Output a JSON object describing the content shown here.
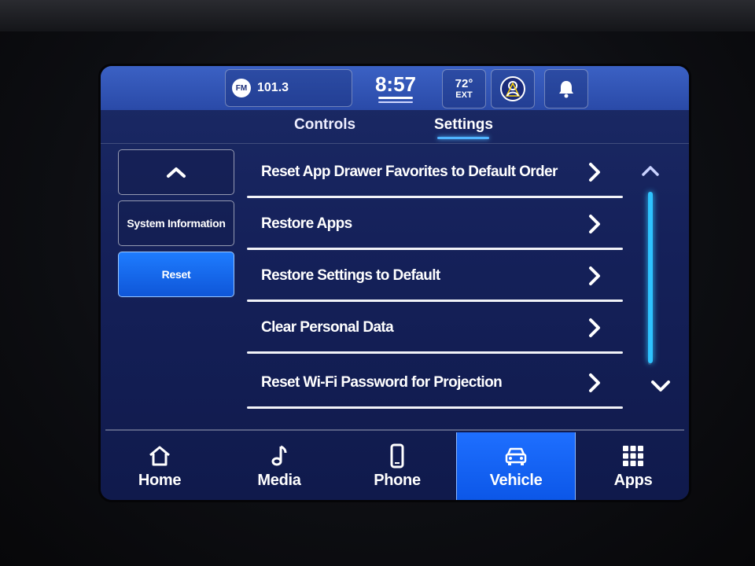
{
  "status_bar": {
    "radio_band": "FM",
    "radio_frequency": "101.3",
    "clock": "8:57",
    "temperature": "72°",
    "temperature_label": "EXT"
  },
  "tabs": [
    {
      "label": "Controls",
      "active": false
    },
    {
      "label": "Settings",
      "active": true
    }
  ],
  "sidebar": {
    "items": [
      {
        "label": "System Information",
        "active": false
      },
      {
        "label": "Reset",
        "active": true
      }
    ]
  },
  "list": {
    "items": [
      {
        "label": "Reset App Drawer Favorites to Default Order"
      },
      {
        "label": "Restore Apps"
      },
      {
        "label": "Restore Settings to Default"
      },
      {
        "label": "Clear Personal Data"
      },
      {
        "label": "Reset Wi-Fi Password for Projection"
      }
    ]
  },
  "bottom_nav": {
    "items": [
      {
        "label": "Home",
        "icon": "home-icon",
        "active": false
      },
      {
        "label": "Media",
        "icon": "music-note-icon",
        "active": false
      },
      {
        "label": "Phone",
        "icon": "phone-icon",
        "active": false
      },
      {
        "label": "Vehicle",
        "icon": "car-icon",
        "active": true
      },
      {
        "label": "Apps",
        "icon": "grid-icon",
        "active": false
      }
    ]
  },
  "colors": {
    "accent": "#1e6fff",
    "scroll_accent": "#2ec3ff",
    "background": "#15215a",
    "status_bar": "#2a4aa8"
  }
}
